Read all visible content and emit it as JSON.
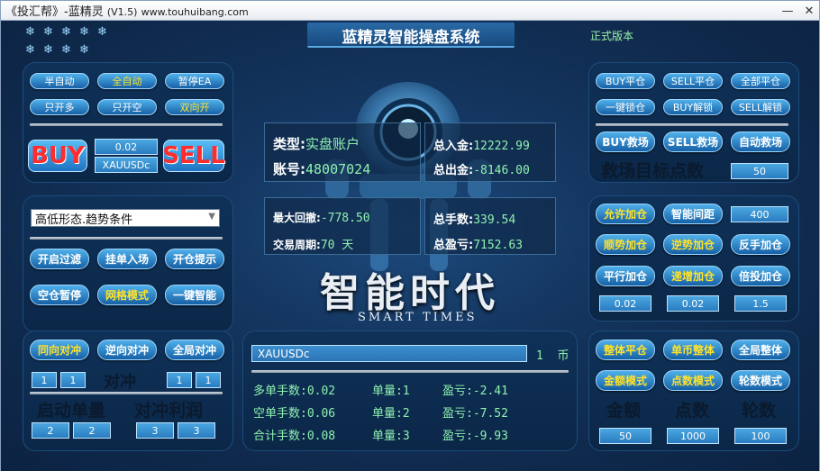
{
  "window": {
    "title_prefix": "《投汇帮》-蓝精灵",
    "title_version": "(V1.5)",
    "title_url": "www.touhuibang.com"
  },
  "header": {
    "title": "蓝精灵智能操盘系统",
    "edition": "正式版本"
  },
  "left_top": {
    "row1": [
      "半自动",
      "全自动",
      "暂停EA"
    ],
    "row2": [
      "只开多",
      "只开空",
      "双向开"
    ],
    "buy": "BUY",
    "sell": "SELL",
    "lot": "0.02",
    "symbol": "XAUUSDc"
  },
  "left_mid": {
    "dropdown": "高低形态.趋势条件",
    "row1": [
      "开启过滤",
      "挂单入场",
      "开仓提示"
    ],
    "row2": [
      "空仓暂停",
      "网格模式",
      "一键智能"
    ]
  },
  "left_bot": {
    "row1": [
      "同向对冲",
      "逆向对冲",
      "全局对冲"
    ],
    "hedge_label": "对冲",
    "hedge_vals": [
      "1",
      "1",
      "1",
      "1"
    ],
    "start_label": "启动单量",
    "profit_label": "对冲利润",
    "start_vals": [
      "2",
      "2"
    ],
    "profit_vals": [
      "3",
      "3"
    ]
  },
  "center": {
    "type_key": "类型:",
    "type_val": "实盘账户",
    "acct_key": "账号:",
    "acct_val": "48007024",
    "in_key": "总入金:",
    "in_val": "12222.99",
    "out_key": "总出金:",
    "out_val": "-8146.00",
    "dd_key": "最大回撤:",
    "dd_val": "-778.50",
    "period_key": "交易周期:",
    "period_val": "70 天",
    "hands_key": "总手数:",
    "hands_val": "339.54",
    "pl_key": "总盈亏:",
    "pl_val": "7152.63",
    "brand_cn": "智能时代",
    "brand_en": "SMART TIMES"
  },
  "bottom_center": {
    "symbol": "XAUUSDc",
    "coin_count": "1",
    "coin_unit": "币",
    "rows": [
      [
        "多单手数:0.02",
        "单量:1",
        "盈亏:-2.41"
      ],
      [
        "空单手数:0.06",
        "单量:2",
        "盈亏:-7.52"
      ],
      [
        "合计手数:0.08",
        "单量:3",
        "盈亏:-9.93"
      ]
    ]
  },
  "right_top": {
    "row1": [
      "BUY平仓",
      "SELL平仓",
      "全部平仓"
    ],
    "row2": [
      "一键锁仓",
      "BUY解锁",
      "SELL解锁"
    ],
    "row3": [
      "BUY救场",
      "SELL救场",
      "自动救场"
    ],
    "target_label": "救场目标点数",
    "target_val": "50"
  },
  "right_mid": {
    "row1": [
      "允许加仓",
      "智能间距"
    ],
    "interval": "400",
    "row2": [
      "顺势加仓",
      "逆势加仓",
      "反手加仓"
    ],
    "row3": [
      "平行加仓",
      "递增加仓",
      "倍投加仓"
    ],
    "vals": [
      "0.02",
      "0.02",
      "1.5"
    ]
  },
  "right_bot": {
    "row1": [
      "整体平仓",
      "单币整体",
      "全局整体"
    ],
    "row2": [
      "金额模式",
      "点数模式",
      "轮数模式"
    ],
    "labels": [
      "金额",
      "点数",
      "轮数"
    ],
    "vals": [
      "50",
      "1000",
      "100"
    ]
  },
  "colors": {
    "accent_yellow": "#ffe22a",
    "green_text": "#8ff0b0",
    "buy_sell_red": "#ff2d2d"
  }
}
